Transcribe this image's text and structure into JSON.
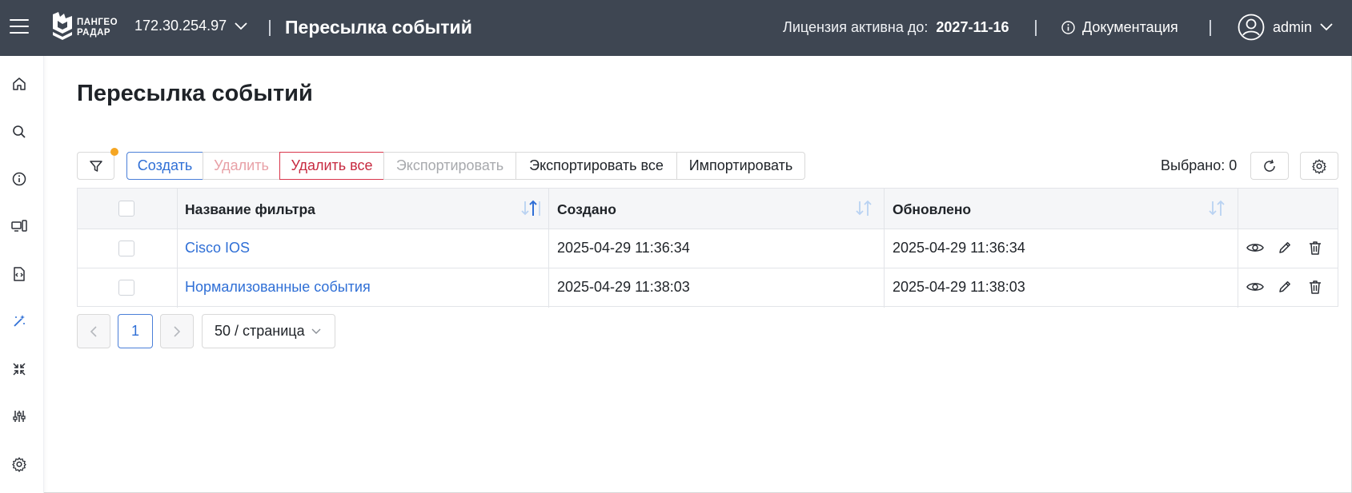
{
  "header": {
    "logo_line1": "ПАНГЕО",
    "logo_line2": "РАДАР",
    "host": "172.30.254.97",
    "title": "Пересылка событий",
    "license_label": "Лицензия активна до:",
    "license_date": "2027-11-16",
    "docs_label": "Документация",
    "user": "admin",
    "bg_color": "#3e4652"
  },
  "sidebar": {
    "items": [
      {
        "icon": "home-icon"
      },
      {
        "icon": "search-icon"
      },
      {
        "icon": "info-icon"
      },
      {
        "icon": "devices-icon"
      },
      {
        "icon": "code-file-icon"
      },
      {
        "icon": "magic-wand-icon",
        "active": true
      },
      {
        "icon": "compress-arrows-icon"
      },
      {
        "icon": "sliders-icon"
      },
      {
        "icon": "settings-gear-icon"
      }
    ]
  },
  "page": {
    "title": "Пересылка событий"
  },
  "toolbar": {
    "create": "Создать",
    "delete": "Удалить",
    "delete_all": "Удалить все",
    "export": "Экспортировать",
    "export_all": "Экспортировать все",
    "import": "Импортировать",
    "selected": "Выбрано: 0"
  },
  "table": {
    "columns": [
      "Название фильтра",
      "Создано",
      "Обновлено"
    ],
    "rows": [
      {
        "name": "Cisco IOS",
        "created": "2025-04-29 11:36:34",
        "updated": "2025-04-29 11:36:34"
      },
      {
        "name": "Нормализованные события",
        "created": "2025-04-29 11:38:03",
        "updated": "2025-04-29 11:38:03"
      }
    ]
  },
  "pagination": {
    "current_page": "1",
    "page_size": "50 / страница"
  },
  "colors": {
    "accent": "#2f6fd6",
    "danger": "#c72a40",
    "badge": "#f5a623"
  }
}
